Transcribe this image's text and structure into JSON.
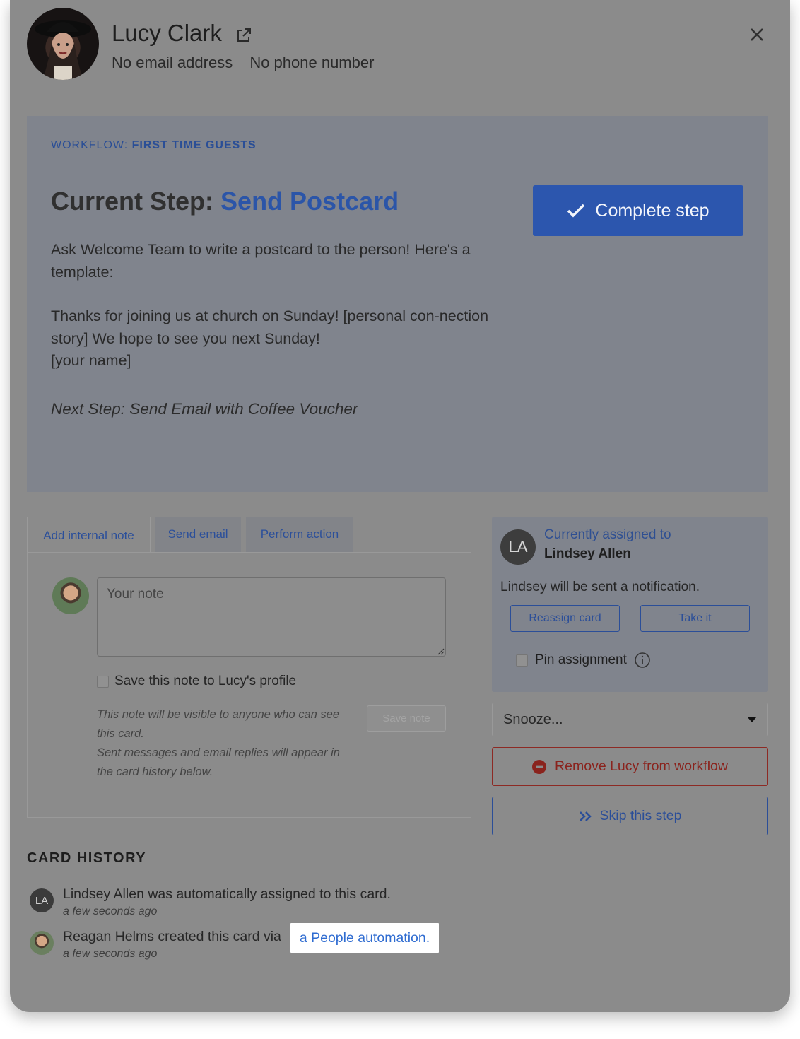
{
  "person": {
    "name": "Lucy Clark",
    "email": "No email address",
    "phone": "No phone number"
  },
  "workflow": {
    "label_prefix": "WORKFLOW:",
    "label_name": "FIRST TIME GUESTS",
    "current_step_prefix": "Current Step:",
    "current_step_name": "Send Postcard",
    "complete_button": "Complete step",
    "description_1": "Ask Welcome Team to write a postcard to the person! Here's a template:",
    "description_2": "Thanks for joining us at church on Sunday! [personal con-nection story] We hope to see you next Sunday!",
    "description_3": "[your name]",
    "next_step": "Next Step: Send Email with Coffee Voucher"
  },
  "tabs": [
    {
      "label": "Add internal note"
    },
    {
      "label": "Send email"
    },
    {
      "label": "Perform action"
    }
  ],
  "note": {
    "placeholder": "Your note",
    "save_to_profile": "Save this note to Lucy's profile",
    "help_1": "This note will be visible to anyone who can see this card.",
    "help_2": "Sent messages and email replies will appear in the card history below.",
    "save_button": "Save note"
  },
  "assignment": {
    "initials": "LA",
    "label": "Currently assigned to",
    "assignee": "Lindsey Allen",
    "notification": "Lindsey will be sent a notification.",
    "reassign_button": "Reassign card",
    "take_button": "Take it",
    "pin_label": "Pin assignment"
  },
  "actions": {
    "snooze": "Snooze...",
    "remove": "Remove Lucy from workflow",
    "skip": "Skip this step"
  },
  "history": {
    "title": "CARD HISTORY",
    "items": [
      {
        "initials": "LA",
        "text": "Lindsey Allen was automatically assigned to this card.",
        "time": "a few seconds ago"
      },
      {
        "text": "Reagan Helms created this card via",
        "link": "a People automation.",
        "time": "a few seconds ago"
      }
    ]
  }
}
